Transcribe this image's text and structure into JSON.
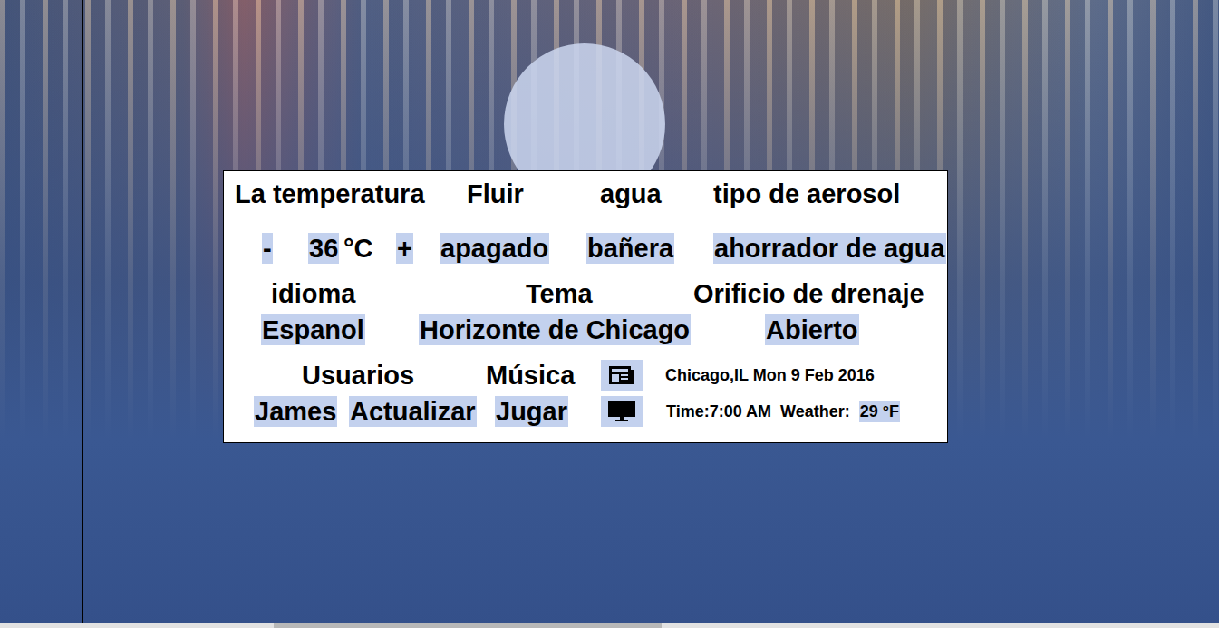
{
  "panel": {
    "temperature": {
      "label": "La temperatura",
      "decrease": "-",
      "value": "36",
      "unit": "°C",
      "increase": "+"
    },
    "flow": {
      "label": "Fluir",
      "value": "apagado"
    },
    "water": {
      "label": "agua",
      "value": "bañera"
    },
    "spray": {
      "label": "tipo de aerosol",
      "value": "ahorrador de agua"
    },
    "language": {
      "label": "idioma",
      "value": "Espanol"
    },
    "theme": {
      "label": "Tema",
      "value": "Horizonte de Chicago"
    },
    "drain": {
      "label": "Orificio de drenaje",
      "value": "Abierto"
    },
    "users": {
      "label": "Usuarios",
      "user": "James",
      "update": "Actualizar"
    },
    "music": {
      "label": "Música",
      "action": "Jugar"
    },
    "info": {
      "location_date": "Chicago,IL Mon 9 Feb 2016",
      "time": "Time:7:00 AM",
      "weather_label": "Weather:",
      "weather_value": "29 °F"
    }
  },
  "scrollbar": {
    "level": 0.318
  }
}
